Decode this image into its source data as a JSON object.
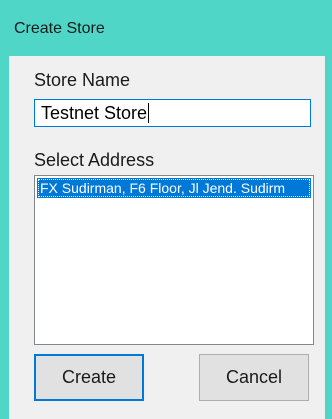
{
  "window": {
    "title": "Create Store"
  },
  "form": {
    "store_name_label": "Store Name",
    "store_name_value": "Testnet Store",
    "address_label": "Select Address",
    "address_options": [
      "FX Sudirman, F6 Floor, Jl Jend. Sudirm"
    ],
    "selected_address_index": 0
  },
  "buttons": {
    "create_label": "Create",
    "cancel_label": "Cancel"
  },
  "colors": {
    "titlebar": "#4fd6c6",
    "client": "#f0f0f0",
    "accent": "#0078d7"
  }
}
